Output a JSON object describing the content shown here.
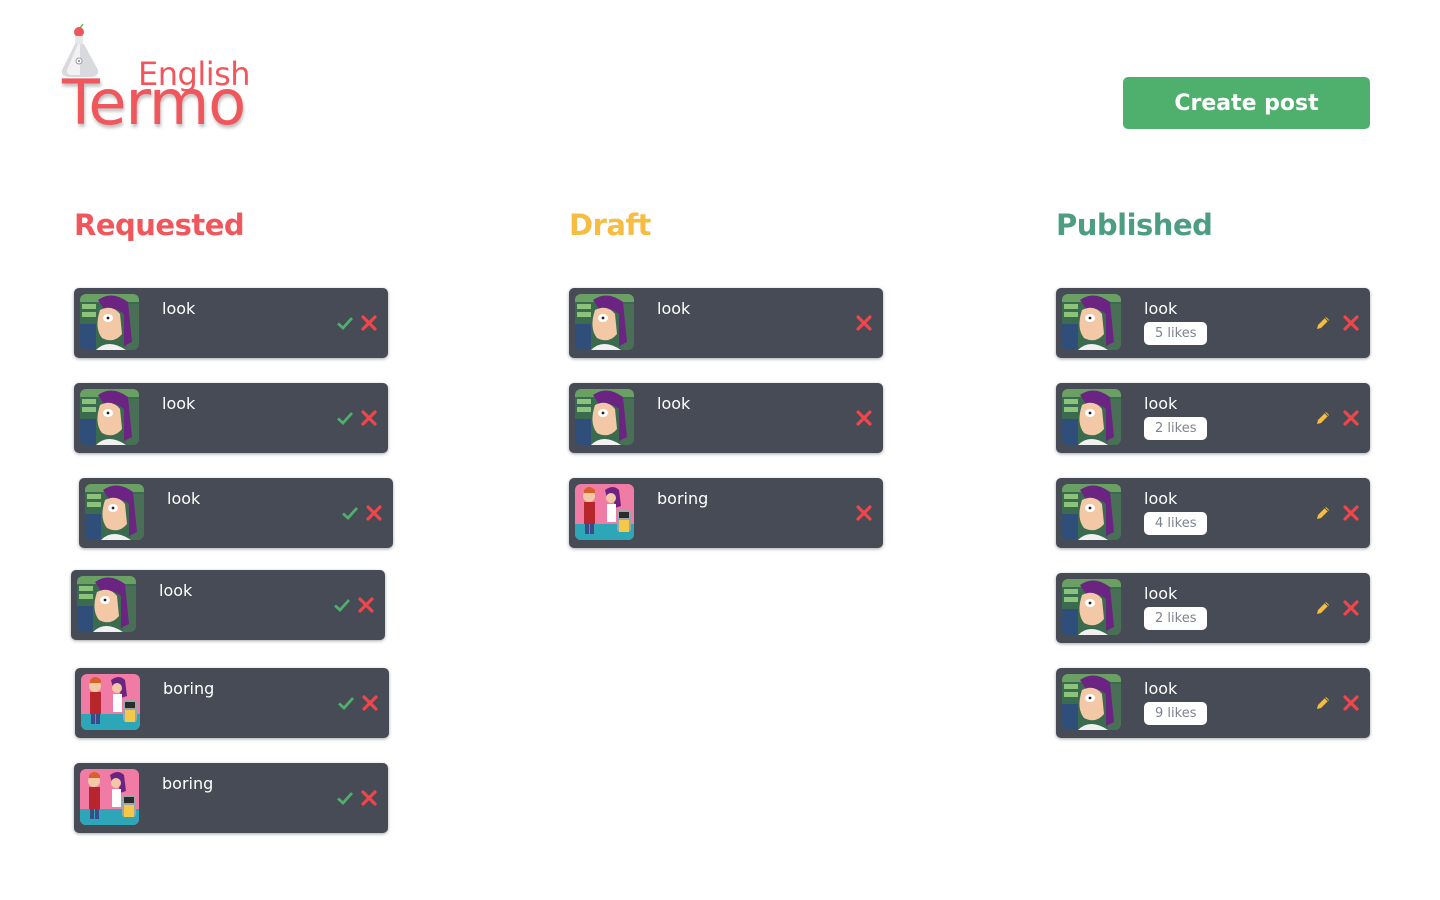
{
  "logo": {
    "sub": "English",
    "main": "Termo"
  },
  "header": {
    "create_label": "Create post"
  },
  "columns": [
    {
      "title": "Requested",
      "color": "#f0575c"
    },
    {
      "title": "Draft",
      "color": "#f6bd42"
    },
    {
      "title": "Published",
      "color": "#4d9d82"
    }
  ],
  "requested": [
    {
      "title": "look",
      "thumb": "character-thumb"
    },
    {
      "title": "look",
      "thumb": "character-thumb"
    },
    {
      "title": "look",
      "thumb": "character-thumb"
    },
    {
      "title": "look",
      "thumb": "character-thumb"
    },
    {
      "title": "boring",
      "thumb": "group-thumb"
    },
    {
      "title": "boring",
      "thumb": "group-thumb"
    }
  ],
  "draft": [
    {
      "title": "look",
      "thumb": "character-thumb"
    },
    {
      "title": "look",
      "thumb": "character-thumb"
    },
    {
      "title": "boring",
      "thumb": "group-thumb"
    }
  ],
  "published": [
    {
      "title": "look",
      "likes": "5 likes",
      "thumb": "character-thumb"
    },
    {
      "title": "look",
      "likes": "2 likes",
      "thumb": "character-thumb"
    },
    {
      "title": "look",
      "likes": "4 likes",
      "thumb": "character-thumb"
    },
    {
      "title": "look",
      "likes": "2 likes",
      "thumb": "character-thumb"
    },
    {
      "title": "look",
      "likes": "9 likes",
      "thumb": "character-thumb"
    }
  ],
  "icons": {
    "approve": "check-icon",
    "delete": "close-icon",
    "edit": "pencil-icon"
  },
  "colors": {
    "card": "#464b55",
    "approve": "#4fb06e",
    "delete": "#f0454b",
    "edit": "#f6bd42",
    "button": "#4fb06e"
  }
}
